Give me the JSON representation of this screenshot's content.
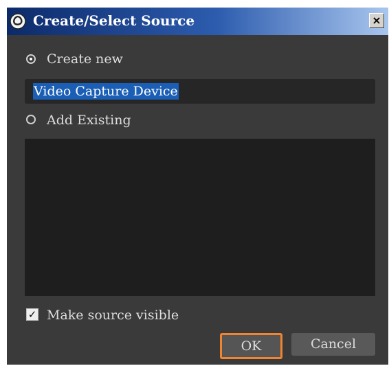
{
  "window": {
    "title": "Create/Select Source",
    "close_label": "×",
    "app_icon": "obs-logo-icon"
  },
  "form": {
    "create_new_label": "Create new",
    "create_new_selected": true,
    "name_value": "Video Capture Device",
    "add_existing_label": "Add Existing",
    "add_existing_selected": false,
    "existing_sources": [],
    "make_visible_label": "Make source visible",
    "make_visible_checked": true,
    "checkmark": "✓"
  },
  "buttons": {
    "ok_label": "OK",
    "cancel_label": "Cancel",
    "ok_highlight_color": "#f08430"
  }
}
